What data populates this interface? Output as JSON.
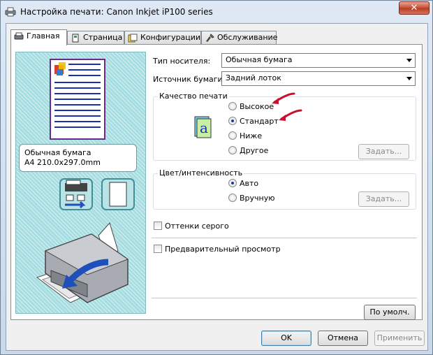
{
  "window": {
    "title": "Настройка печати: Canon Inkjet iP100 series",
    "close_symbol": "✕",
    "title_icon": "printer-icon"
  },
  "tabs": [
    {
      "label": "Главная",
      "icon": "main-tab-icon",
      "active": true
    },
    {
      "label": "Страница",
      "icon": "page-tab-icon",
      "active": false
    },
    {
      "label": "Конфигурации",
      "icon": "profile-tab-icon",
      "active": false
    },
    {
      "label": "Обслуживание",
      "icon": "maintenance-tab-icon",
      "active": false
    }
  ],
  "preview": {
    "paper_type": "Обычная бумага",
    "paper_size": "A4 210.0x297.0mm"
  },
  "media": {
    "label": "Тип носителя:",
    "value": "Обычная бумага"
  },
  "source": {
    "label": "Источник бумаги:",
    "value": "Задний лоток"
  },
  "quality": {
    "title": "Качество печати",
    "options": [
      "Высокое",
      "Стандарт",
      "Ниже",
      "Другое"
    ],
    "selected": "Стандарт",
    "set_button": "Задать..."
  },
  "color": {
    "title": "Цвет/интенсивность",
    "options": [
      "Авто",
      "Вручную"
    ],
    "selected": "Авто",
    "set_button": "Задать..."
  },
  "grayscale": {
    "label": "Оттенки серого",
    "checked": false
  },
  "preview_before_print": {
    "label": "Предварительный просмотр",
    "checked": false
  },
  "defaults_button": "По умолч.",
  "footer": {
    "ok": "OK",
    "cancel": "Отмена",
    "apply": "Применить"
  },
  "colors": {
    "preview_bg": "#a6dde1",
    "annotation_arrow": "#c8102e",
    "printer_arrow": "#1f4fb8"
  }
}
